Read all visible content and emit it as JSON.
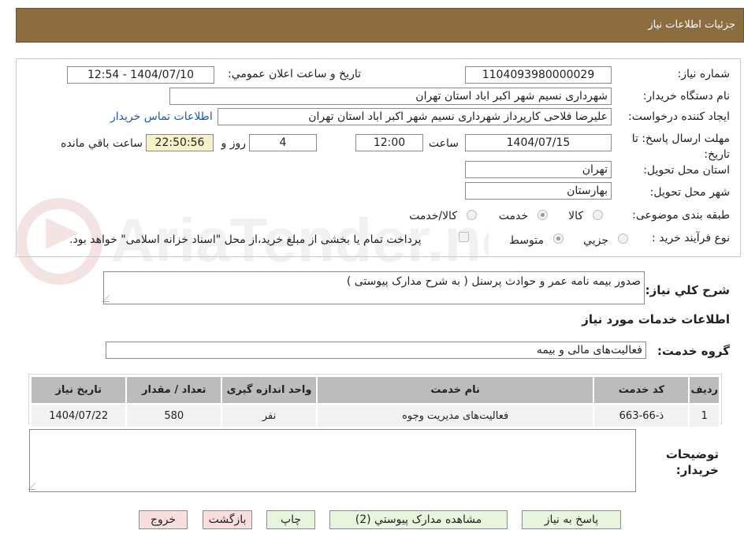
{
  "header": {
    "title": "جزئیات اطلاعات نیاز"
  },
  "fields": {
    "need_number_label": "شماره نیاز:",
    "need_number": "1104093980000029",
    "announce_label": "تاریخ و ساعت اعلان عمومي:",
    "announce_value": "1404/07/10 - 12:54",
    "buyer_org_label": "نام دستگاه خريدار:",
    "buyer_org": "شهرداری نسیم شهر اکبر اباد استان تهران",
    "requester_label": "ايجاد کننده درخواست:",
    "requester": "علیرضا فلاحی کارپرداز شهرداری نسیم شهر اکبر اباد استان تهران",
    "contact_link": "اطلاعات تماس خريدار",
    "deadline_label": "مهلت ارسال پاسخ: تا تاریخ:",
    "deadline_date": "1404/07/15",
    "hour_label": "ساعت",
    "deadline_time": "12:00",
    "days_value": "4",
    "days_label": "روز و",
    "remaining_time": "22:50:56",
    "remaining_label": "ساعت باقي مانده",
    "province_label": "استان محل تحويل:",
    "province": "تهران",
    "city_label": "شهر محل تحويل:",
    "city": "بهارستان",
    "category_label": "طبقه بندی موضوعی:",
    "category_options": [
      "کالا",
      "خدمت",
      "کالا/خدمت"
    ],
    "process_label": "نوع فرآیند خرید :",
    "process_options": [
      "جزيي",
      "متوسط"
    ],
    "payment_note": "پرداخت تمام يا بخشی از مبلغ خريد،از محل \"اسناد خزانه اسلامی\" خواهد بود."
  },
  "description": {
    "label": "شرح کلي نياز:",
    "text": "صدور بیمه نامه عمر و حوادث پرسنل ( به شرح مدارک پیوستی )"
  },
  "services_section": {
    "title": "اطلاعات خدمات مورد نياز",
    "group_label": "گروه خدمت:",
    "group_value": "فعالیت‌های مالی و بیمه"
  },
  "table": {
    "headers": [
      "رديف",
      "کد خدمت",
      "نام خدمت",
      "واحد اندازه گيری",
      "تعداد / مقدار",
      "تاريخ نياز"
    ],
    "rows": [
      [
        "1",
        "ذ-66-663",
        "فعالیت‌های مدیریت وجوه",
        "نفر",
        "580",
        "1404/07/22"
      ]
    ]
  },
  "buyer_notes": {
    "label": "توضيحات خريدار:"
  },
  "buttons": {
    "reply": "پاسخ به نياز",
    "attachments": "مشاهده مدارک پيوستي (2)",
    "print": "چاپ",
    "back": "بازگشت",
    "exit": "خروج"
  },
  "watermark": {
    "text": "AriaTender.neT"
  },
  "colors": {
    "header_bg": "#8c6d40",
    "link": "#1a55c8",
    "timer_bg": "#f7f1c8",
    "button_green": "#e7f5dd",
    "button_red": "#f9dede",
    "table_header": "#bcbcbc"
  }
}
